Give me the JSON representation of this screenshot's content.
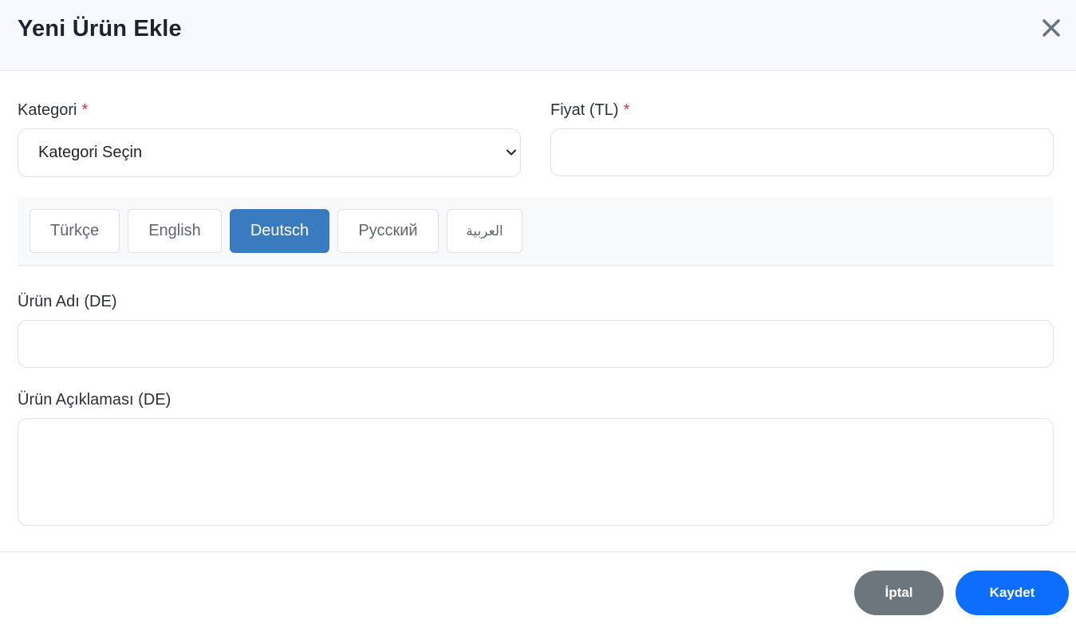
{
  "modal": {
    "title": "Yeni Ürün Ekle",
    "close_icon": "close-icon"
  },
  "form": {
    "category": {
      "label": "Kategori",
      "required_mark": "*",
      "selected": "Kategori Seçin"
    },
    "price": {
      "label": "Fiyat (TL)",
      "required_mark": "*",
      "value": ""
    },
    "languages": {
      "tabs": [
        {
          "label": "Türkçe",
          "active": false
        },
        {
          "label": "English",
          "active": false
        },
        {
          "label": "Deutsch",
          "active": true
        },
        {
          "label": "Русский",
          "active": false
        },
        {
          "label": "العربية",
          "active": false
        }
      ]
    },
    "product_name": {
      "label": "Ürün Adı (DE)",
      "value": ""
    },
    "product_description": {
      "label": "Ürün Açıklaması (DE)",
      "value": ""
    }
  },
  "footer": {
    "cancel_label": "İptal",
    "save_label": "Kaydet"
  },
  "colors": {
    "header_bg": "#f7f9fd",
    "active_tab": "#3a7bc0",
    "cancel_button": "#6d757d",
    "save_button": "#0d6efd",
    "required": "#dc3545"
  }
}
